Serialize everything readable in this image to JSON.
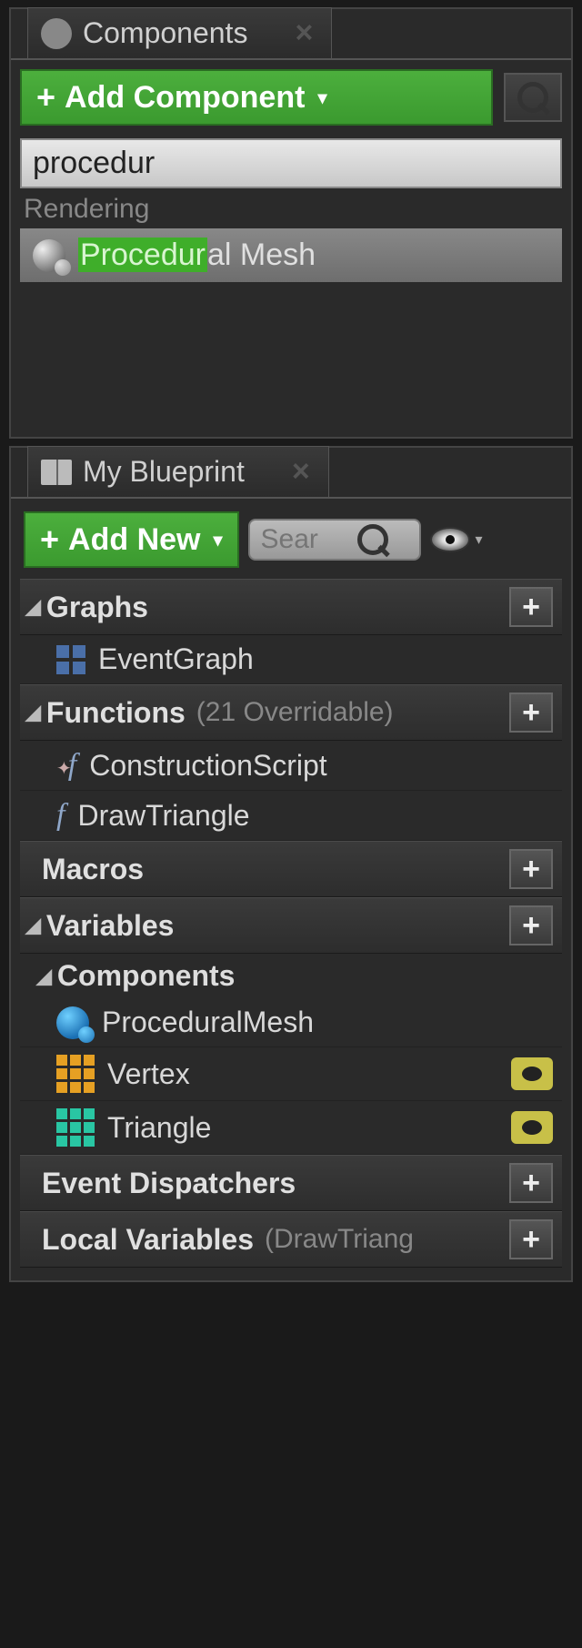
{
  "components_panel": {
    "title": "Components",
    "add_button": "Add Component",
    "search_value": "procedur",
    "category": "Rendering",
    "result_prefix": "Procedur",
    "result_suffix": "al Mesh"
  },
  "blueprint_panel": {
    "title": "My Blueprint",
    "add_button": "Add New",
    "search_placeholder": "Sear",
    "sections": {
      "graphs": {
        "label": "Graphs",
        "items": {
          "event_graph": "EventGraph"
        }
      },
      "functions": {
        "label": "Functions",
        "hint": "(21 Overridable)",
        "items": {
          "construction": "ConstructionScript",
          "draw_triangle": "DrawTriangle"
        }
      },
      "macros": {
        "label": "Macros"
      },
      "variables": {
        "label": "Variables"
      },
      "components_sub": {
        "label": "Components",
        "items": {
          "proc_mesh": "ProceduralMesh",
          "vertex": "Vertex",
          "triangle": "Triangle"
        }
      },
      "event_dispatchers": {
        "label": "Event Dispatchers"
      },
      "local_vars": {
        "label": "Local Variables",
        "hint": "(DrawTriang"
      }
    }
  }
}
